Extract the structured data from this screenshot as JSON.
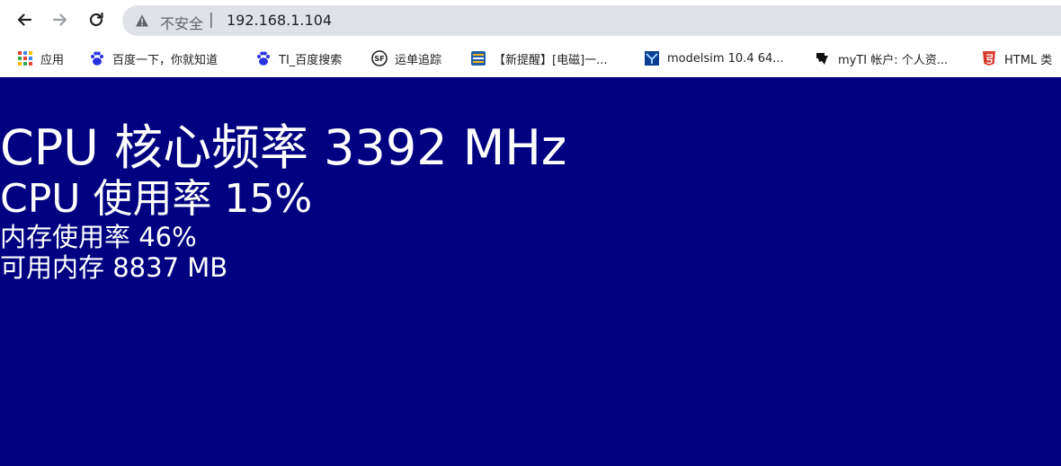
{
  "browser": {
    "nav": {
      "back_icon": "arrow-left-icon",
      "forward_icon": "arrow-right-icon",
      "reload_icon": "reload-icon"
    },
    "address_bar": {
      "security_icon": "warning-triangle-icon",
      "security_label": "不安全",
      "separator": "|",
      "url": "192.168.1.104"
    },
    "bookmarks": [
      {
        "label": "应用",
        "icon": "apps-grid-icon"
      },
      {
        "label": "百度一下，你就知道",
        "icon": "baidu-paw-icon"
      },
      {
        "label": "TI_百度搜索",
        "icon": "baidu-paw-icon"
      },
      {
        "label": "运单追踪",
        "icon": "sf-express-icon"
      },
      {
        "label": "【新提醒】[电磁]一...",
        "icon": "zhi-badge-icon"
      },
      {
        "label": "modelsim 10.4 64...",
        "icon": "modelsim-icon"
      },
      {
        "label": "myTI 帐户: 个人资...",
        "icon": "ti-logo-icon"
      },
      {
        "label": "HTML 类",
        "icon": "html5-shield-icon"
      }
    ]
  },
  "page": {
    "background": "#000080",
    "text_color": "#ffffff",
    "lines": [
      "CPU 核心频率 3392 MHz",
      "CPU 使用率 15%",
      "内存使用率 46%",
      "可用内存 8837 MB"
    ]
  }
}
